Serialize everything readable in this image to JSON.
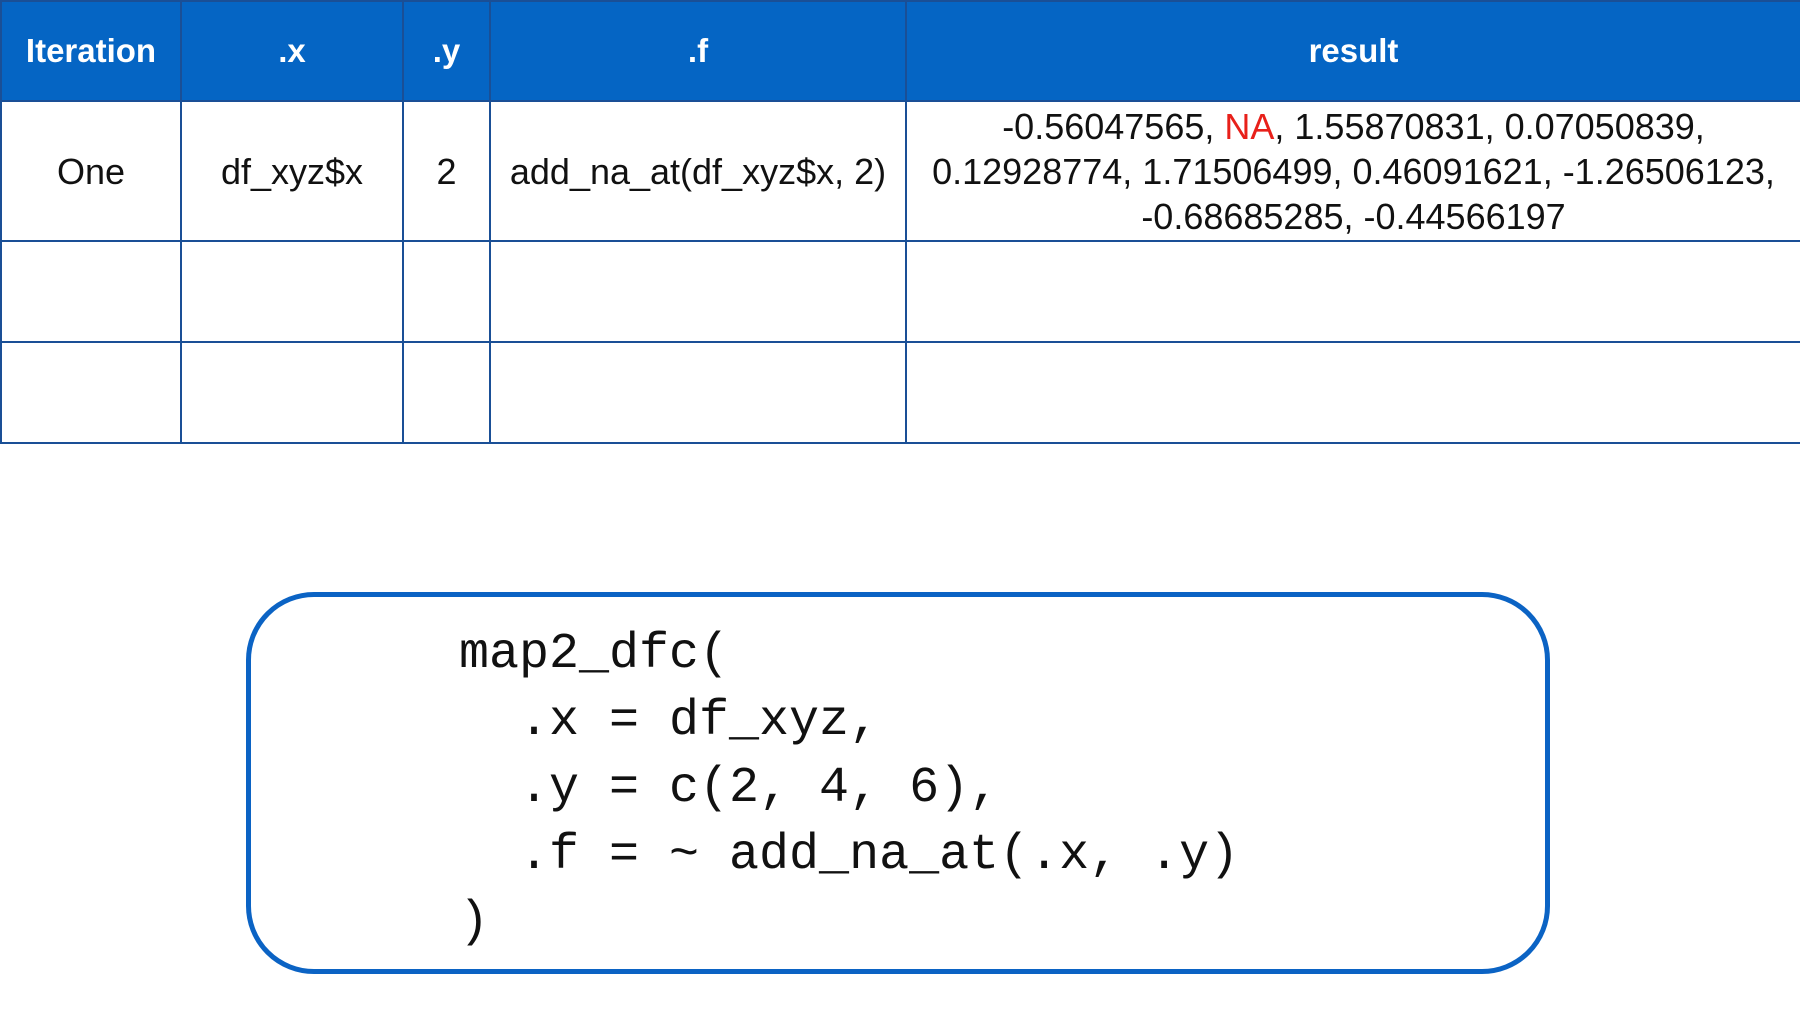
{
  "table": {
    "headers": [
      "Iteration",
      ".x",
      ".y",
      ".f",
      "result"
    ],
    "rows": [
      {
        "iteration": "One",
        "x": "df_xyz$x",
        "y": "2",
        "f": "add_na_at(df_xyz$x, 2)",
        "result": {
          "line1_pre": "-0.56047565, ",
          "line1_na": "NA",
          "line1_post": ", 1.55870831, 0.07050839,",
          "line2": "0.12928774, 1.71506499, 0.46091621, -1.26506123,",
          "line3": "-0.68685285, -0.44566197"
        }
      },
      {
        "iteration": "",
        "x": "",
        "y": "",
        "f": "",
        "result": ""
      },
      {
        "iteration": "",
        "x": "",
        "y": "",
        "f": "",
        "result": ""
      }
    ]
  },
  "code": {
    "lines": [
      "map2_dfc(",
      "  .x = df_xyz,",
      "  .y = c(2, 4, 6),",
      "  .f = ~ add_na_at(.x, .y)",
      ")"
    ]
  },
  "colors": {
    "header_bg": "#0565c4",
    "border": "#1a4f96",
    "na": "#e8201a",
    "code_border": "#0b63c4"
  }
}
